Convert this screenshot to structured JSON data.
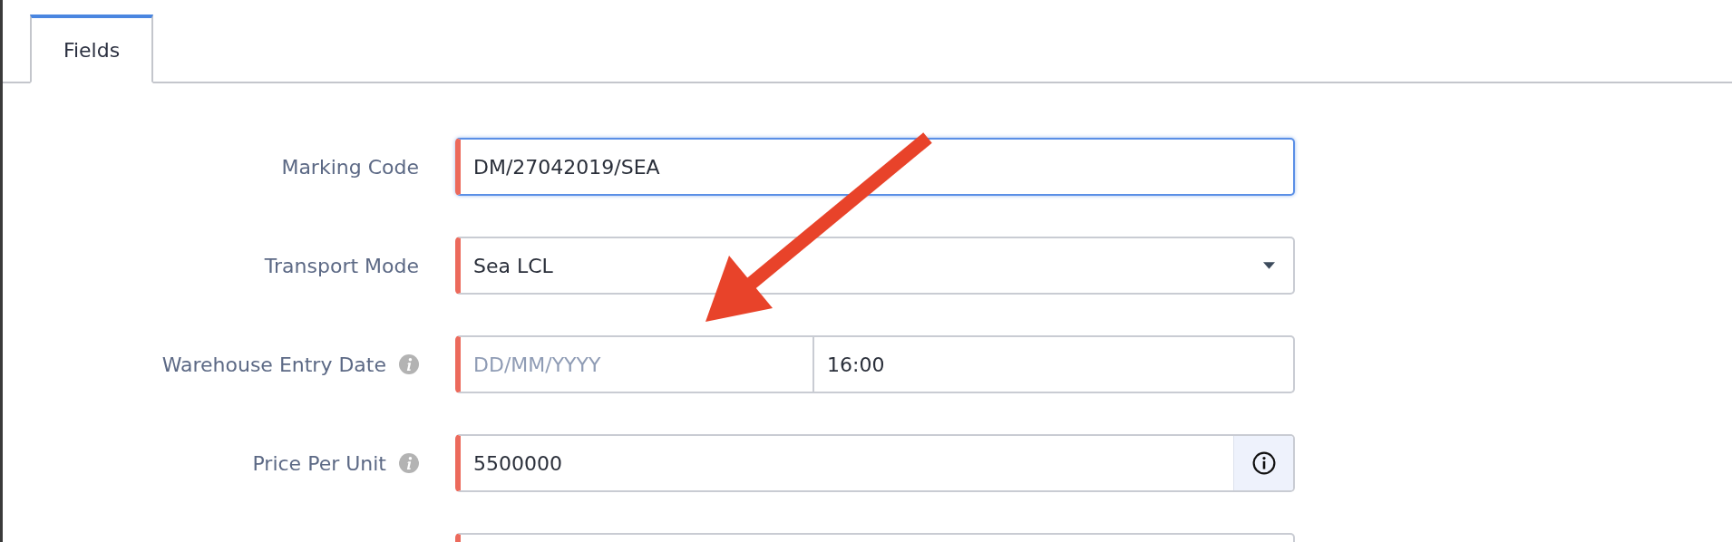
{
  "tabs": [
    {
      "label": "Fields",
      "selected": true
    }
  ],
  "fields": [
    {
      "kind": "text",
      "label": "Marking Code",
      "value": "DM/27042019/SEA",
      "required": true,
      "focused": true,
      "info": false
    },
    {
      "kind": "select",
      "label": "Transport Mode",
      "value": "Sea LCL",
      "required": true,
      "focused": false,
      "info": false
    },
    {
      "kind": "datetime",
      "label": "Warehouse Entry Date",
      "placeholder": "DD/MM/YYYY",
      "time_value": "16:00",
      "required": true,
      "focused": false,
      "info": true
    },
    {
      "kind": "number",
      "label": "Price Per Unit",
      "value": "5500000",
      "required": true,
      "focused": false,
      "info": true
    },
    {
      "kind": "text",
      "required": true,
      "focused": false,
      "info": false
    }
  ]
}
